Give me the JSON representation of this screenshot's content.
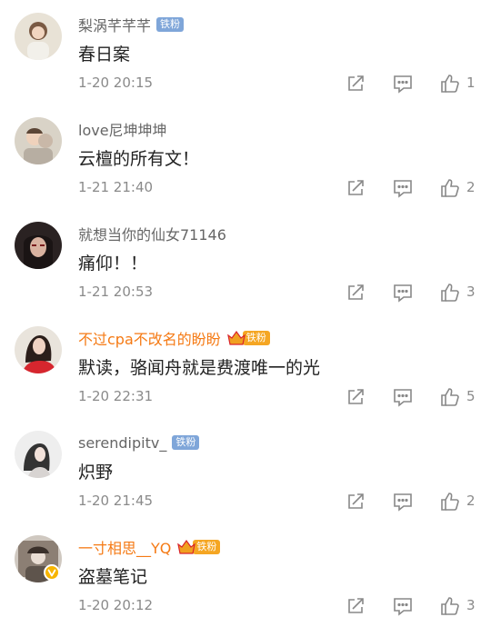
{
  "comments": [
    {
      "name": "梨涡芊芊芊",
      "name_color": "gray",
      "badge": {
        "type": "blue",
        "label": "铁粉"
      },
      "text": "春日案",
      "time": "1-20 20:15",
      "likes": "1"
    },
    {
      "name": "love尼坤坤坤",
      "name_color": "gray",
      "badge": null,
      "text": "云檀的所有文！",
      "time": "1-21 21:40",
      "likes": "2"
    },
    {
      "name": "就想当你的仙女71146",
      "name_color": "gray",
      "badge": null,
      "text": "痛仰！！",
      "time": "1-21 20:53",
      "likes": "3"
    },
    {
      "name": "不过cpa不改名的盼盼",
      "name_color": "orange",
      "badge": {
        "type": "orange",
        "label": "铁粉"
      },
      "text": "默读，骆闻舟就是费渡唯一的光",
      "time": "1-20 22:31",
      "likes": "5"
    },
    {
      "name": "serendipitv_",
      "name_color": "gray",
      "badge": {
        "type": "blue",
        "label": "铁粉"
      },
      "text": "炽野",
      "time": "1-20 21:45",
      "likes": "2"
    },
    {
      "name": "一寸相思__YQ",
      "name_color": "orange",
      "badge": {
        "type": "orange",
        "label": "铁粉"
      },
      "text": "盗墓笔记",
      "time": "1-20 20:12",
      "likes": "3",
      "verified": true
    }
  ],
  "icons": {
    "share": "share-icon",
    "reply": "comment-icon",
    "like": "thumbs-up-icon",
    "crown": "crown-icon",
    "verified": "verified-v-icon"
  },
  "colors": {
    "name_gray": "#666666",
    "name_vip": "#f57a14",
    "badge_blue": "#7fa6d9",
    "badge_orange": "#f5a623",
    "meta": "#8a8a8a",
    "text": "#222222"
  }
}
